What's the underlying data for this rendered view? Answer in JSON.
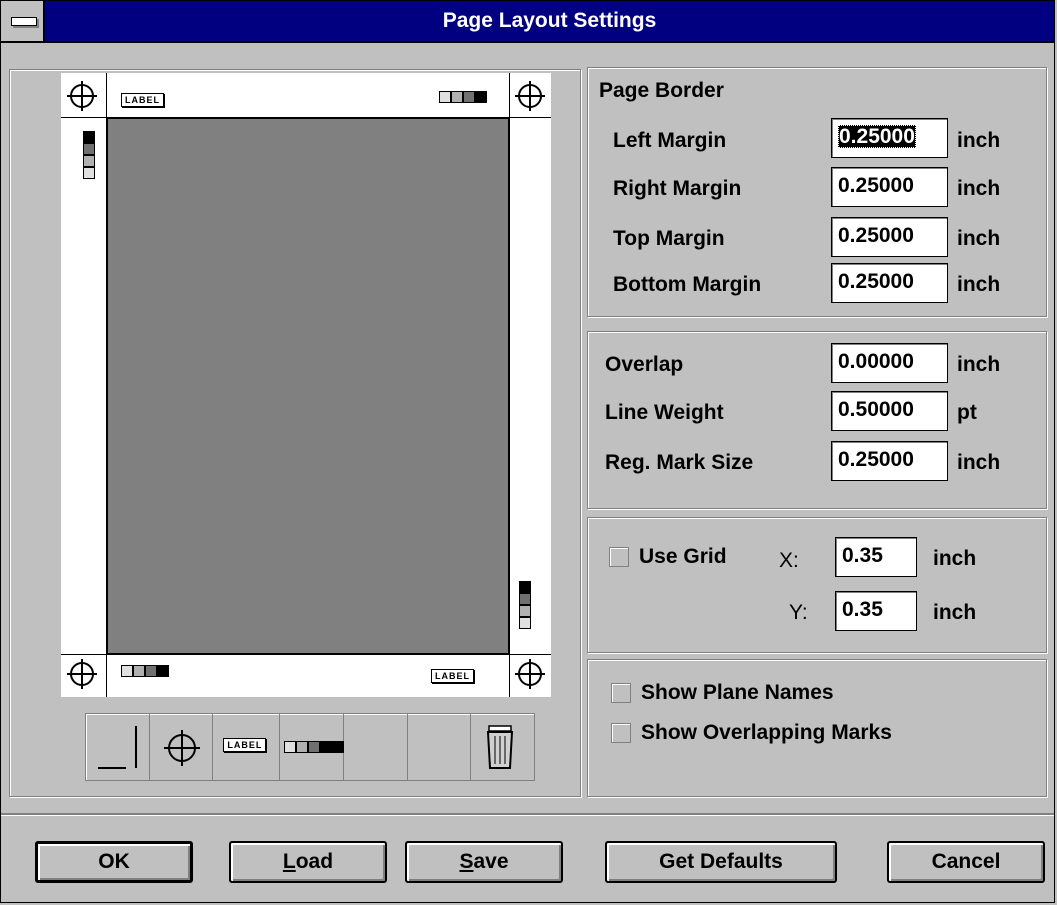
{
  "window": {
    "title": "Page Layout Settings"
  },
  "page_border": {
    "heading": "Page Border",
    "left": {
      "label": "Left Margin",
      "value": "0.25000",
      "unit": "inch"
    },
    "right": {
      "label": "Right Margin",
      "value": "0.25000",
      "unit": "inch"
    },
    "top": {
      "label": "Top Margin",
      "value": "0.25000",
      "unit": "inch"
    },
    "bottom": {
      "label": "Bottom Margin",
      "value": "0.25000",
      "unit": "inch"
    }
  },
  "marks": {
    "overlap": {
      "label": "Overlap",
      "value": "0.00000",
      "unit": "inch"
    },
    "line_weight": {
      "label": "Line Weight",
      "value": "0.50000",
      "unit": "pt"
    },
    "reg_mark_size": {
      "label": "Reg. Mark Size",
      "value": "0.25000",
      "unit": "inch"
    }
  },
  "grid": {
    "use_label": "Use Grid",
    "checked": false,
    "x_label": "X:",
    "x_value": "0.35",
    "x_unit": "inch",
    "y_label": "Y:",
    "y_value": "0.35",
    "y_unit": "inch"
  },
  "options": {
    "show_plane_names": {
      "label": "Show Plane Names",
      "checked": false
    },
    "show_overlapping": {
      "label": "Show Overlapping Marks",
      "checked": false
    }
  },
  "preview": {
    "label_tag": "LABEL"
  },
  "buttons": {
    "ok": "OK",
    "load_mnemonic": "L",
    "load_rest": "oad",
    "save_mnemonic": "S",
    "save_rest": "ave",
    "get_defaults": "Get Defaults",
    "cancel": "Cancel"
  }
}
